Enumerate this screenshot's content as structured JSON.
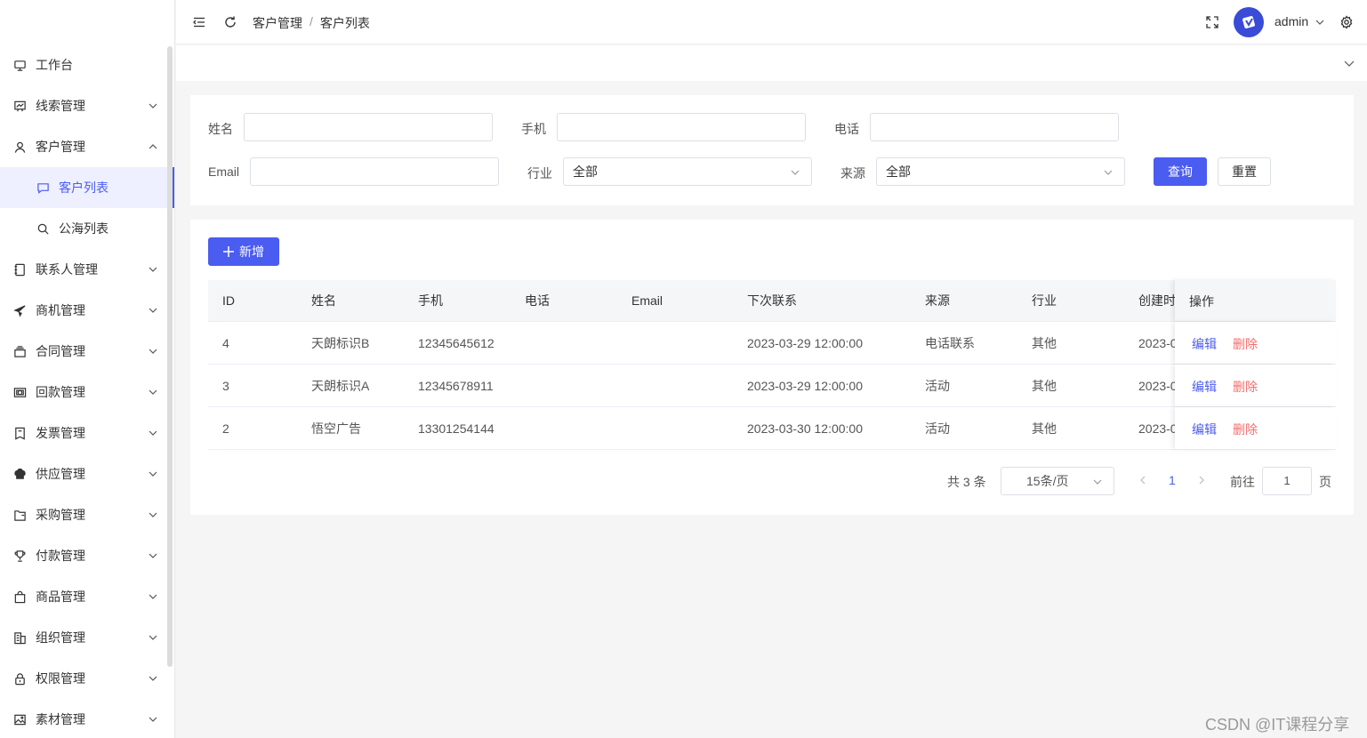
{
  "header": {
    "breadcrumb": [
      "客户管理",
      "客户列表"
    ],
    "breadcrumb_sep": "/",
    "username": "admin"
  },
  "sidebar": {
    "items": [
      {
        "label": "工作台",
        "icon": "monitor-icon",
        "arrow": ""
      },
      {
        "label": "线索管理",
        "icon": "chart-board-icon",
        "arrow": "down"
      },
      {
        "label": "客户管理",
        "icon": "user-icon",
        "arrow": "up"
      },
      {
        "label": "客户列表",
        "icon": "chat-bubble-icon",
        "arrow": "",
        "sub": true,
        "active": true
      },
      {
        "label": "公海列表",
        "icon": "search-icon",
        "arrow": "",
        "sub": true
      },
      {
        "label": "联系人管理",
        "icon": "notebook-icon",
        "arrow": "down"
      },
      {
        "label": "商机管理",
        "icon": "paper-plane-icon",
        "arrow": "down"
      },
      {
        "label": "合同管理",
        "icon": "files-icon",
        "arrow": "down"
      },
      {
        "label": "回款管理",
        "icon": "money-icon",
        "arrow": "down"
      },
      {
        "label": "发票管理",
        "icon": "receipt-icon",
        "arrow": "down"
      },
      {
        "label": "供应管理",
        "icon": "chef-hat-icon",
        "arrow": "down"
      },
      {
        "label": "采购管理",
        "icon": "folder-icon",
        "arrow": "down"
      },
      {
        "label": "付款管理",
        "icon": "trophy-icon",
        "arrow": "down"
      },
      {
        "label": "商品管理",
        "icon": "shopping-bag-icon",
        "arrow": "down"
      },
      {
        "label": "组织管理",
        "icon": "building-icon",
        "arrow": "down"
      },
      {
        "label": "权限管理",
        "icon": "lock-icon",
        "arrow": "down"
      },
      {
        "label": "素材管理",
        "icon": "picture-icon",
        "arrow": "down"
      }
    ]
  },
  "search": {
    "name_label": "姓名",
    "mobile_label": "手机",
    "phone_label": "电话",
    "email_label": "Email",
    "industry_label": "行业",
    "industry_value": "全部",
    "source_label": "来源",
    "source_value": "全部",
    "query_button": "查询",
    "reset_button": "重置"
  },
  "toolbar": {
    "add_button": "新增"
  },
  "table": {
    "columns": [
      "ID",
      "姓名",
      "手机",
      "电话",
      "Email",
      "下次联系",
      "来源",
      "行业",
      "创建时",
      "操作"
    ],
    "rows": [
      {
        "id": "4",
        "name": "天朗标识B",
        "mobile": "12345645612",
        "phone": "",
        "email": "",
        "next_contact": "2023-03-29 12:00:00",
        "source": "电话联系",
        "industry": "其他",
        "created": "2023-0"
      },
      {
        "id": "3",
        "name": "天朗标识A",
        "mobile": "12345678911",
        "phone": "",
        "email": "",
        "next_contact": "2023-03-29 12:00:00",
        "source": "活动",
        "industry": "其他",
        "created": "2023-0"
      },
      {
        "id": "2",
        "name": "悟空广告",
        "mobile": "13301254144",
        "phone": "",
        "email": "",
        "next_contact": "2023-03-30 12:00:00",
        "source": "活动",
        "industry": "其他",
        "created": "2023-0"
      }
    ],
    "edit_label": "编辑",
    "delete_label": "删除"
  },
  "pagination": {
    "total": "共 3 条",
    "page_size": "15条/页",
    "current_page": "1",
    "goto_label": "前往",
    "goto_value": "1",
    "page_suffix": "页"
  },
  "watermark": "CSDN @IT课程分享",
  "colors": {
    "primary": "#4b5cf0",
    "danger": "#f56c6c",
    "background": "#f5f5f5"
  }
}
